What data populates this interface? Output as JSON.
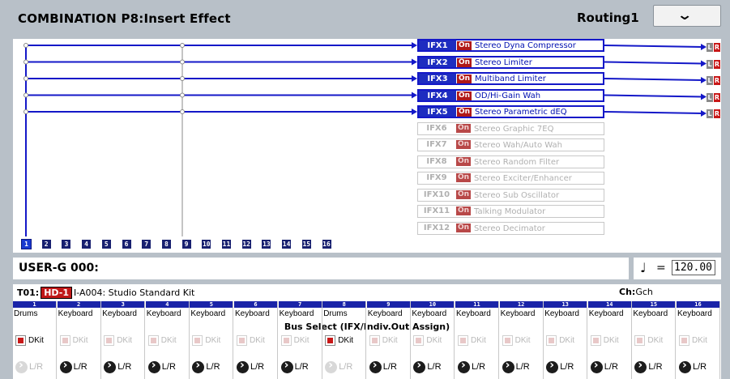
{
  "header": {
    "title": "COMBINATION P8:Insert Effect",
    "page": "Routing1",
    "menu_icon": "chevron-down-icon"
  },
  "routing": {
    "ifx": [
      {
        "slot": "IFX1",
        "on": "On",
        "name": "Stereo Dyna Compressor",
        "active": true
      },
      {
        "slot": "IFX2",
        "on": "On",
        "name": "Stereo Limiter",
        "active": true
      },
      {
        "slot": "IFX3",
        "on": "On",
        "name": "Multiband Limiter",
        "active": true
      },
      {
        "slot": "IFX4",
        "on": "On",
        "name": "OD/Hi-Gain Wah",
        "active": true
      },
      {
        "slot": "IFX5",
        "on": "On",
        "name": "Stereo Parametric dEQ",
        "active": true
      },
      {
        "slot": "IFX6",
        "on": "On",
        "name": "Stereo Graphic 7EQ",
        "active": false
      },
      {
        "slot": "IFX7",
        "on": "On",
        "name": "Stereo Wah/Auto Wah",
        "active": false
      },
      {
        "slot": "IFX8",
        "on": "On",
        "name": "Stereo Random Filter",
        "active": false
      },
      {
        "slot": "IFX9",
        "on": "On",
        "name": "Stereo Exciter/Enhancer",
        "active": false
      },
      {
        "slot": "IFX10",
        "on": "On",
        "name": "Stereo Sub Oscillator",
        "active": false
      },
      {
        "slot": "IFX11",
        "on": "On",
        "name": "Talking Modulator",
        "active": false
      },
      {
        "slot": "IFX12",
        "on": "On",
        "name": "Stereo Decimator",
        "active": false
      }
    ],
    "outputs": {
      "l": "L",
      "r": "R"
    },
    "timbre_numbers": [
      "1",
      "2",
      "3",
      "4",
      "5",
      "6",
      "7",
      "8",
      "9",
      "10",
      "11",
      "12",
      "13",
      "14",
      "15",
      "16"
    ],
    "selected_timbre": "1"
  },
  "combi": {
    "name": "USER-G 000:",
    "tempo_label": "=",
    "tempo": "120.00"
  },
  "timbre_info": {
    "timbre": "T01:",
    "bank": "HD-1",
    "program": "I-A004: Studio Standard Kit",
    "ch_label": "Ch:",
    "ch_value": "Gch"
  },
  "bus_select_label": "Bus Select (IFX/Indiv.Out Assign)",
  "timbres": [
    {
      "num": "1",
      "type": "Drums",
      "dkit": "DKit",
      "dkit_on": true,
      "bus": "L/R",
      "bus_on": false
    },
    {
      "num": "2",
      "type": "Keyboard",
      "dkit": "DKit",
      "dkit_on": false,
      "bus": "L/R",
      "bus_on": true
    },
    {
      "num": "3",
      "type": "Keyboard",
      "dkit": "DKit",
      "dkit_on": false,
      "bus": "L/R",
      "bus_on": true
    },
    {
      "num": "4",
      "type": "Keyboard",
      "dkit": "DKit",
      "dkit_on": false,
      "bus": "L/R",
      "bus_on": true
    },
    {
      "num": "5",
      "type": "Keyboard",
      "dkit": "DKit",
      "dkit_on": false,
      "bus": "L/R",
      "bus_on": true
    },
    {
      "num": "6",
      "type": "Keyboard",
      "dkit": "DKit",
      "dkit_on": false,
      "bus": "L/R",
      "bus_on": true
    },
    {
      "num": "7",
      "type": "Keyboard",
      "dkit": "DKit",
      "dkit_on": false,
      "bus": "L/R",
      "bus_on": true
    },
    {
      "num": "8",
      "type": "Drums",
      "dkit": "DKit",
      "dkit_on": true,
      "bus": "L/R",
      "bus_on": false
    },
    {
      "num": "9",
      "type": "Keyboard",
      "dkit": "DKit",
      "dkit_on": false,
      "bus": "L/R",
      "bus_on": true
    },
    {
      "num": "10",
      "type": "Keyboard",
      "dkit": "DKit",
      "dkit_on": false,
      "bus": "L/R",
      "bus_on": true
    },
    {
      "num": "11",
      "type": "Keyboard",
      "dkit": "DKit",
      "dkit_on": false,
      "bus": "L/R",
      "bus_on": true
    },
    {
      "num": "12",
      "type": "Keyboard",
      "dkit": "DKit",
      "dkit_on": false,
      "bus": "L/R",
      "bus_on": true
    },
    {
      "num": "13",
      "type": "Keyboard",
      "dkit": "DKit",
      "dkit_on": false,
      "bus": "L/R",
      "bus_on": true
    },
    {
      "num": "14",
      "type": "Keyboard",
      "dkit": "DKit",
      "dkit_on": false,
      "bus": "L/R",
      "bus_on": true
    },
    {
      "num": "15",
      "type": "Keyboard",
      "dkit": "DKit",
      "dkit_on": false,
      "bus": "L/R",
      "bus_on": true
    },
    {
      "num": "16",
      "type": "Keyboard",
      "dkit": "DKit",
      "dkit_on": false,
      "bus": "L/R",
      "bus_on": true
    }
  ],
  "colors": {
    "background": "#b8c0c8",
    "ifx_active": "#1e2dc0",
    "on_badge": "#b01818",
    "routing_line": "#1418c8"
  }
}
